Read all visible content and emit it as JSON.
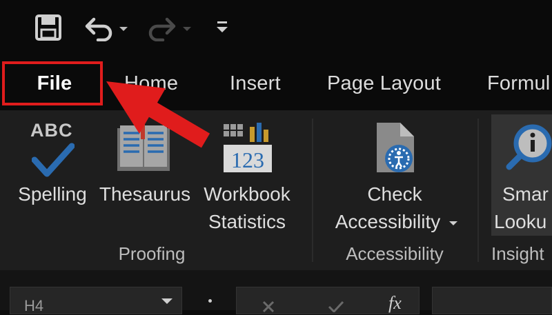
{
  "quick_access": {
    "save_icon": "save-icon",
    "undo_icon": "undo-icon",
    "redo_icon": "redo-icon",
    "customize_icon": "customize-qat-icon"
  },
  "tabs": [
    {
      "id": "file",
      "label": "File"
    },
    {
      "id": "home",
      "label": "Home"
    },
    {
      "id": "insert",
      "label": "Insert"
    },
    {
      "id": "page-layout",
      "label": "Page Layout"
    },
    {
      "id": "formulas",
      "label": "Formul"
    }
  ],
  "ribbon": {
    "proofing": {
      "group_label": "Proofing",
      "spelling": {
        "label": "Spelling",
        "icon_text": "ABC"
      },
      "thesaurus": {
        "label": "Thesaurus"
      },
      "workbook_statistics": {
        "line1": "Workbook",
        "line2": "Statistics",
        "icon_text": "123"
      }
    },
    "accessibility": {
      "group_label": "Accessibility",
      "check": {
        "line1": "Check",
        "line2": "Accessibility"
      }
    },
    "insights": {
      "group_label": "Insight",
      "smart_lookup": {
        "line1": "Smar",
        "line2": "Looku"
      }
    }
  },
  "formula_bar": {
    "name_box_value": "H4",
    "cancel_icon": "cancel-icon",
    "enter_icon": "check-icon",
    "function_label": "fx"
  },
  "colors": {
    "highlight": "#e01c1c",
    "ribbon_bg": "#1e1e1e",
    "title_bg": "#0a0a0a",
    "icon_blue": "#2a6bb0"
  }
}
